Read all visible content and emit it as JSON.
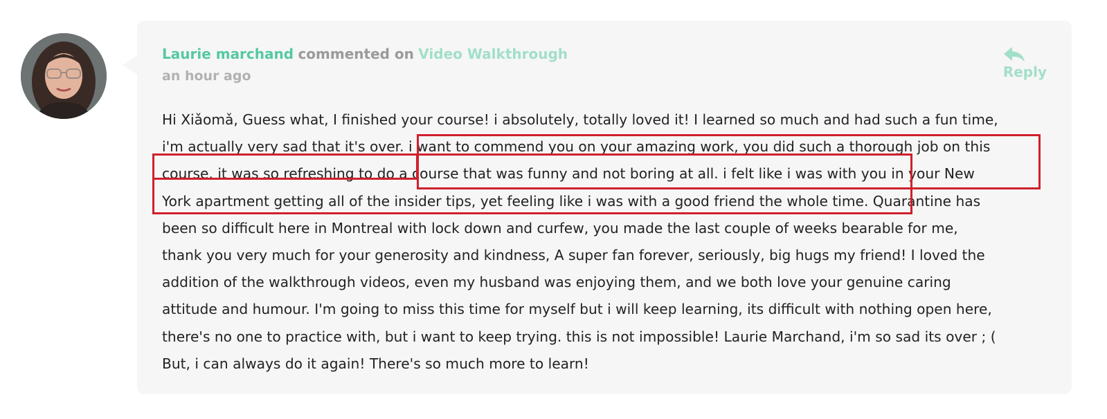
{
  "comment": {
    "author": "Laurie marchand",
    "verb": "commented on",
    "target": "Video Walkthrough",
    "time": "an hour ago",
    "reply_label": "Reply",
    "lines": [
      "Hi Xiǎomǎ, Guess what, I finished your course! i absolutely, totally loved it! I learned so much and had such a fun time,",
      "i'm actually very sad that it's over. i want to commend you on your amazing work, you did such a thorough job on this",
      "course. it was so refreshing to do a course that was funny and not boring at all. i felt like i was with you in your New",
      "York apartment getting all of the insider tips, yet feeling like i was with a good friend the whole time. Quarantine has",
      "been so difficult here in Montreal with lock down and curfew, you made the last couple of weeks bearable for me,",
      "thank you very much for your generosity and kindness, A super fan forever, seriously, big hugs my friend! I loved the",
      "addition of the walkthrough videos, even my husband was enjoying them, and we both love your genuine caring",
      "attitude and humour. I'm going to miss this time for myself but i will keep learning, its difficult with nothing open here,",
      "there's no one to practice with, but i want to keep trying. this is not impossible! Laurie Marchand, i'm so sad its over ; (",
      "But, i can always do it again! There's so much more to learn!"
    ]
  },
  "icons": {
    "reply": "reply-arrow-icon",
    "avatar": "user-avatar"
  },
  "colors": {
    "accent": "#55c9a0",
    "accent_light": "#a2dfc8",
    "highlight": "#d0202c",
    "card_bg": "#f6f6f6"
  }
}
